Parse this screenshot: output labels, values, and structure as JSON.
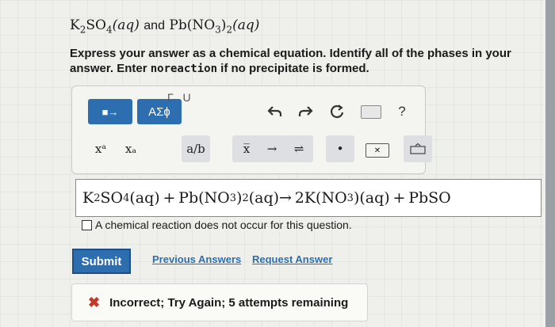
{
  "question": {
    "reactant1_base": "K",
    "reactant1_sub1": "2",
    "reactant1_mid": "SO",
    "reactant1_sub2": "4",
    "reactant1_phase": "(aq)",
    "connector": "and",
    "reactant2_base": "Pb(NO",
    "reactant2_sub1": "3",
    "reactant2_close": ")",
    "reactant2_sub2": "2",
    "reactant2_phase": "(aq)"
  },
  "instructions": {
    "line1": "Express your answer as a chemical equation. Identify all of the phases in your answer. Enter ",
    "code": "noreaction",
    "line2": " if no precipitate is formed."
  },
  "toolbar": {
    "templates_label": "■→",
    "greek_label": "ΑΣϕ",
    "undo_icon": "undo-icon",
    "redo_icon": "redo-icon",
    "reset_icon": "reset-icon",
    "keyboard_icon": "keyboard-icon",
    "help_label": "?",
    "fragment_text": "Г U",
    "superscript_label": "xᵃ",
    "subscript_label": "xₐ",
    "fraction_label": "a/b",
    "vector_label": "x̅",
    "arrow_label": "→",
    "equilibrium_label": "⇌",
    "dot_label": "•",
    "delete_label": "✕"
  },
  "answer": {
    "p1": "K",
    "s1": "2",
    "p2": "SO",
    "s2": "4",
    "p3": "(aq) + Pb(NO",
    "s3": "3",
    "p4": ")",
    "s4": "2",
    "p5": "(aq)→ 2K(NO",
    "s5": "3",
    "p6": ")(aq) + PbSO"
  },
  "no_reaction_label": "A chemical reaction does not occur for this question.",
  "buttons": {
    "submit": "Submit",
    "previous_answers": "Previous Answers",
    "request_answer": "Request Answer"
  },
  "feedback": {
    "message": "Incorrect; Try Again; 5 attempts remaining"
  },
  "colors": {
    "accent": "#2d6eb0",
    "error": "#c0392b"
  }
}
